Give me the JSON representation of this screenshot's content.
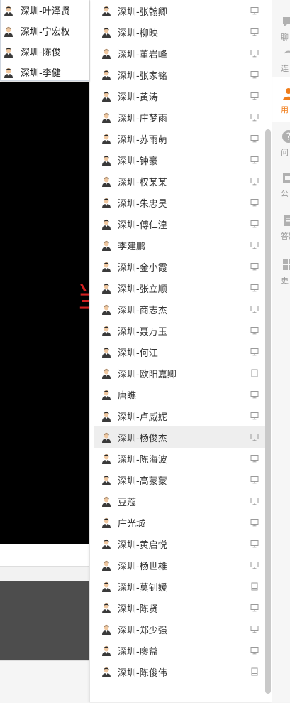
{
  "left_dropdown": {
    "items": [
      {
        "name": "深圳-叶泽贤"
      },
      {
        "name": "深圳-宁宏权"
      },
      {
        "name": "深圳-陈俊"
      },
      {
        "name": "深圳-李健"
      }
    ]
  },
  "contact_list": {
    "items": [
      {
        "name": "深圳-张翰卿",
        "device": "desktop"
      },
      {
        "name": "深圳-柳映",
        "device": "desktop"
      },
      {
        "name": "深圳-董岩峰",
        "device": "desktop"
      },
      {
        "name": "深圳-张家铭",
        "device": "desktop"
      },
      {
        "name": "深圳-黄涛",
        "device": "desktop"
      },
      {
        "name": "深圳-庄梦雨",
        "device": "desktop"
      },
      {
        "name": "深圳-苏雨萌",
        "device": "desktop"
      },
      {
        "name": "深圳-钟豪",
        "device": "desktop"
      },
      {
        "name": "深圳-权某某",
        "device": "desktop"
      },
      {
        "name": "深圳-朱忠昊",
        "device": "desktop"
      },
      {
        "name": "深圳-傅仁湟",
        "device": "desktop"
      },
      {
        "name": "李建鹏",
        "device": "desktop"
      },
      {
        "name": "深圳-金小霞",
        "device": "desktop"
      },
      {
        "name": "深圳-张立顺",
        "device": "desktop"
      },
      {
        "name": "深圳-商志杰",
        "device": "desktop"
      },
      {
        "name": "深圳-聂万玉",
        "device": "desktop"
      },
      {
        "name": "深圳-何江",
        "device": "desktop"
      },
      {
        "name": "深圳-欧阳嘉卿",
        "device": "tablet"
      },
      {
        "name": "唐瞧",
        "device": "desktop"
      },
      {
        "name": "深圳-卢威妮",
        "device": "desktop"
      },
      {
        "name": "深圳-杨俊杰",
        "device": "desktop",
        "highlighted": true
      },
      {
        "name": "深圳-陈海波",
        "device": "desktop"
      },
      {
        "name": "深圳-高蒙蒙",
        "device": "desktop"
      },
      {
        "name": "豆蔻",
        "device": "desktop"
      },
      {
        "name": "庄光城",
        "device": "desktop"
      },
      {
        "name": "深圳-黄启悦",
        "device": "desktop"
      },
      {
        "name": "深圳-杨世雄",
        "device": "desktop"
      },
      {
        "name": "深圳-莫钊媛",
        "device": "tablet"
      },
      {
        "name": "深圳-陈贤",
        "device": "desktop"
      },
      {
        "name": "深圳-郑少强",
        "device": "desktop"
      },
      {
        "name": "深圳-廖益",
        "device": "desktop"
      },
      {
        "name": "深圳-陈俊伟",
        "device": "tablet"
      }
    ]
  },
  "right_nav": {
    "items": [
      {
        "label": "聊",
        "icon": "chat-icon"
      },
      {
        "label": "连",
        "icon": "link-icon"
      },
      {
        "label": "用",
        "icon": "user-icon",
        "active": true
      },
      {
        "label": "问",
        "icon": "question-icon"
      },
      {
        "label": "公",
        "icon": "notice-icon"
      },
      {
        "label": "答题",
        "icon": "quiz-icon"
      },
      {
        "label": "更",
        "icon": "more-icon"
      }
    ]
  },
  "background": {
    "red_mark": "当"
  },
  "colors": {
    "accent": "#f07d1b",
    "row_highlight": "#eeeeee",
    "video_bg": "#000000",
    "red_mark": "#d32020"
  }
}
